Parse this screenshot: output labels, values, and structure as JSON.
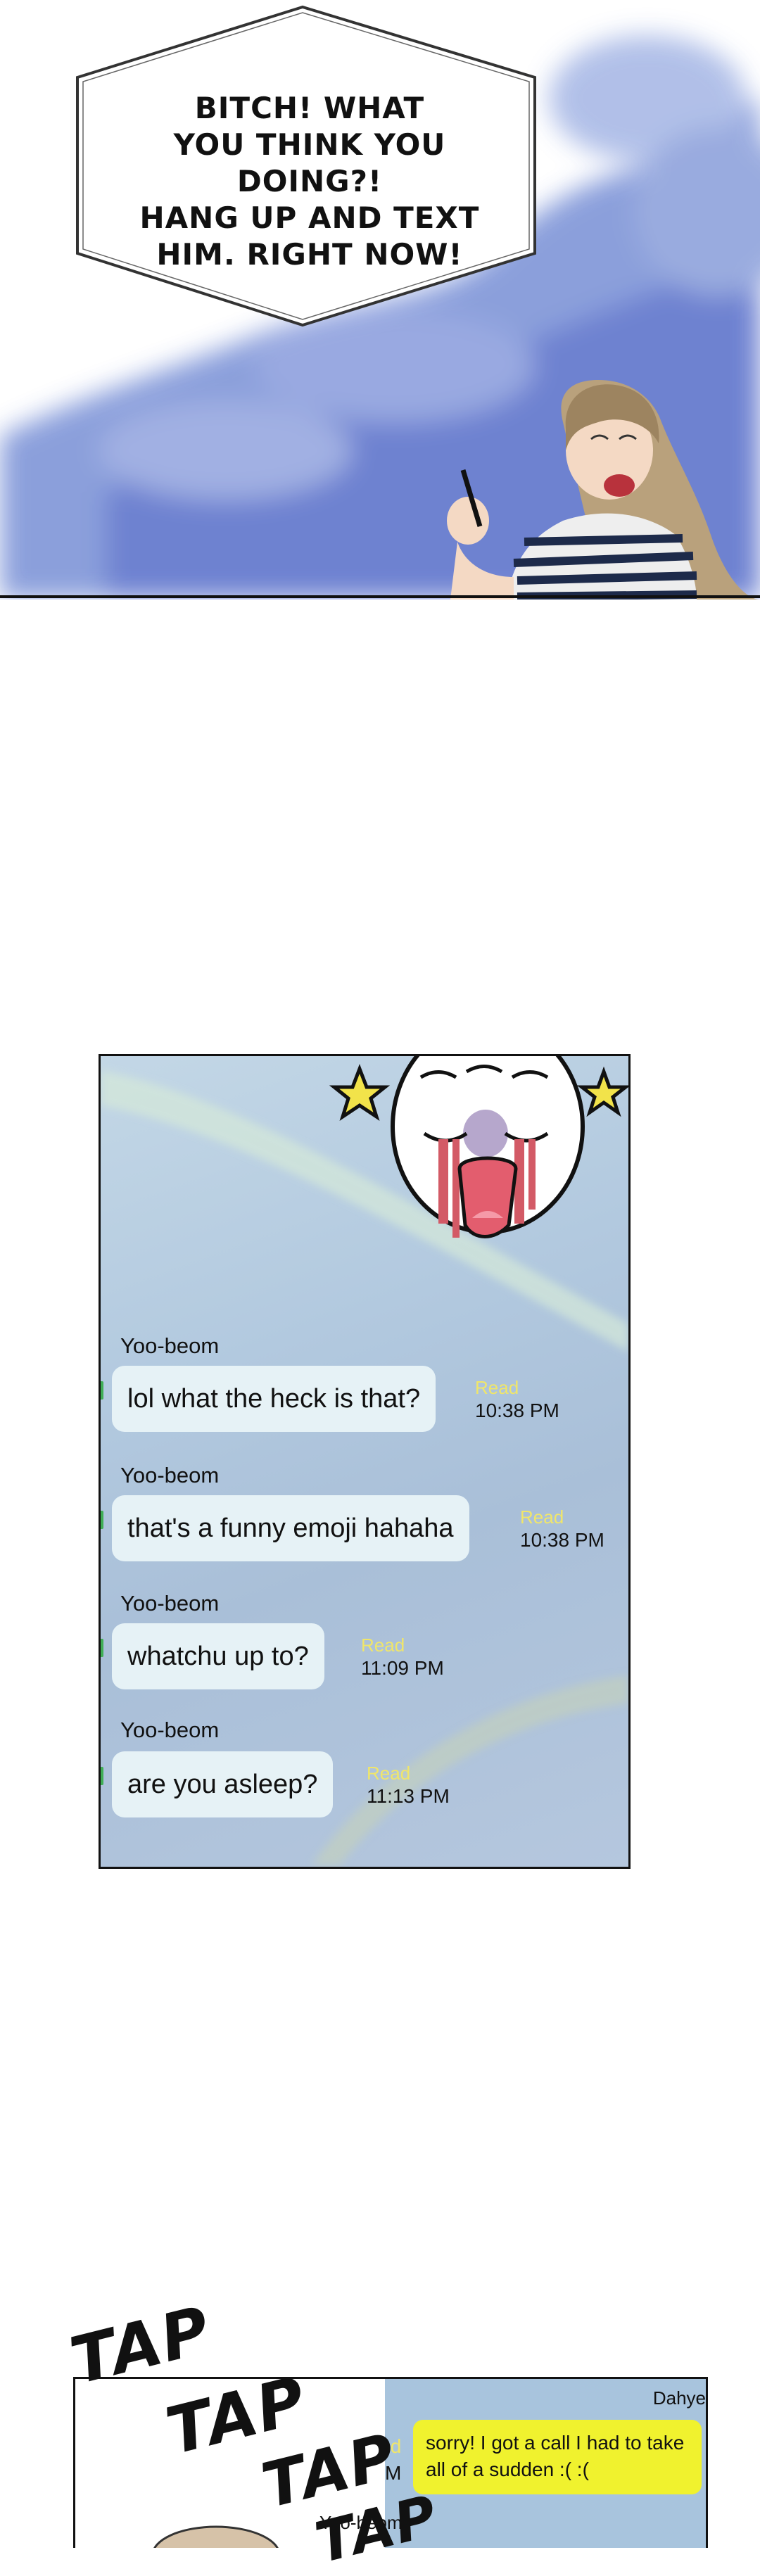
{
  "panel1": {
    "speech_lines": [
      "BITCH! WHAT",
      "YOU THINK YOU DOING?!",
      "HANG UP AND TEXT",
      "HIM. RIGHT NOW!"
    ]
  },
  "panel2": {
    "messages": [
      {
        "sender": "Yoo-beom",
        "text": "lol what the heck is that?",
        "status": "Read",
        "time": "10:38 PM"
      },
      {
        "sender": "Yoo-beom",
        "text": "that's a funny emoji hahaha",
        "status": "Read",
        "time": "10:38 PM"
      },
      {
        "sender": "Yoo-beom",
        "text": "whatchu up to?",
        "status": "Read",
        "time": "11:09 PM"
      },
      {
        "sender": "Yoo-beom",
        "text": "are you asleep?",
        "status": "Read",
        "time": "11:13 PM"
      }
    ]
  },
  "panel3": {
    "sfx": [
      "TAP",
      "TAP",
      "TAP",
      "TAP"
    ],
    "dahye_name": "Dahye",
    "dahye_message": "sorry! I got a call I had to take all of a sudden :( :(",
    "fragment_read": "ıd",
    "fragment_time": "M",
    "yoobeom_name": "Yoo-beom"
  },
  "colors": {
    "bubble": "#e6f2f6",
    "read": "#f0e66a",
    "dahye_bubble": "#f0f22e",
    "chat_bg": "#b2c9df"
  }
}
